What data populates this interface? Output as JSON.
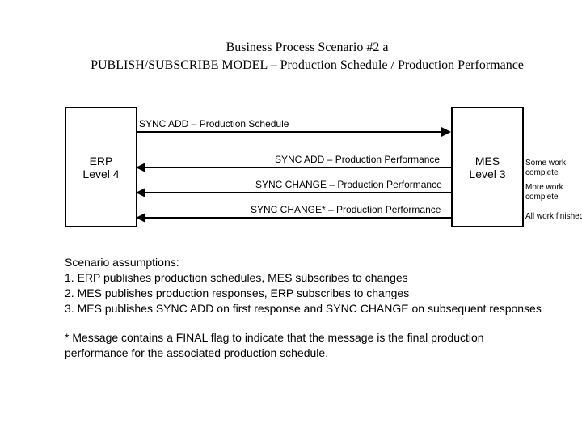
{
  "title": {
    "line1": "Business Process Scenario #2 a",
    "line2": "PUBLISH/SUBSCRIBE MODEL – Production Schedule / Production Performance"
  },
  "left_box": {
    "line1": "ERP",
    "line2": "Level 4"
  },
  "right_box": {
    "line1": "MES",
    "line2": "Level 3"
  },
  "arrows": {
    "a1": "SYNC ADD – Production Schedule",
    "a2": "SYNC ADD – Production Performance",
    "a3": "SYNC CHANGE – Production Performance",
    "a4": "SYNC CHANGE* – Production Performance"
  },
  "notes": {
    "n1a": "Some work",
    "n1b": "complete",
    "n2a": "More work",
    "n2b": "complete",
    "n3": "All work finished"
  },
  "assumptions": {
    "heading": "Scenario assumptions:",
    "item1": "1. ERP publishes production schedules, MES subscribes to changes",
    "item2": "2. MES publishes production responses, ERP subscribes to changes",
    "item3": "3. MES publishes SYNC ADD on first response and SYNC CHANGE on subsequent responses"
  },
  "footnote": "* Message contains a FINAL flag to indicate that the message is the final production performance for the associated production schedule."
}
